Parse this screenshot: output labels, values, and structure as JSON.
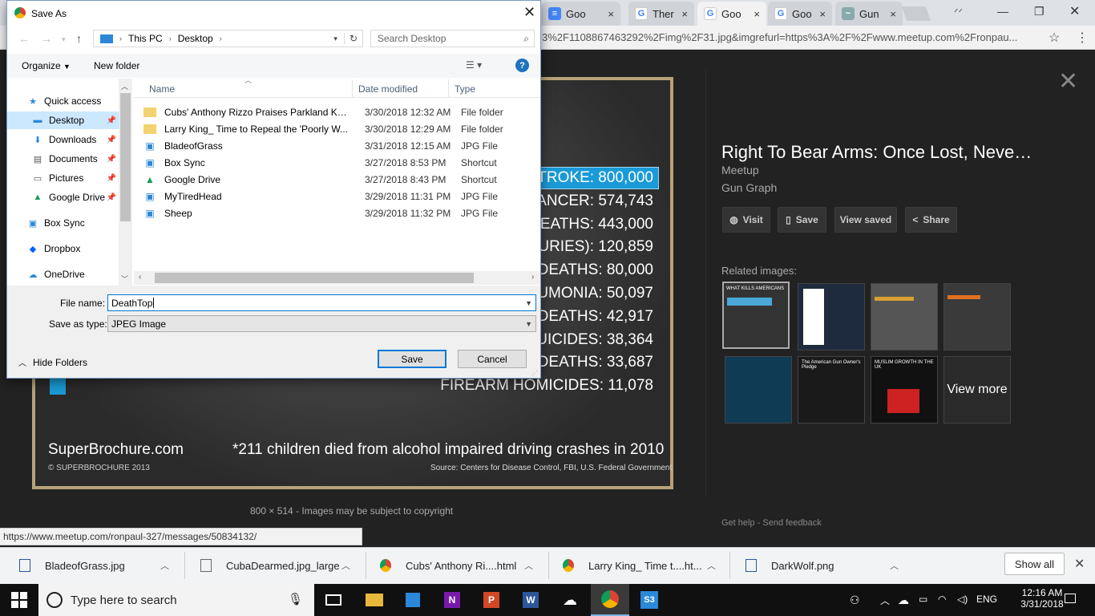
{
  "browser": {
    "tabs": [
      {
        "title": "Goo",
        "icon": "docs"
      },
      {
        "title": "Ther",
        "icon": "google"
      },
      {
        "title": "Goo",
        "icon": "google",
        "active": true
      },
      {
        "title": "Goo",
        "icon": "google"
      },
      {
        "title": "Gun",
        "icon": "image"
      }
    ],
    "url": "3%2F1108867463292%2Fimg%2F31.jpg&imgrefurl=https%3A%2F%2Fwww.meetup.com%2Fronpau..."
  },
  "image": {
    "stats": [
      {
        "text": "STROKE: 800,000",
        "highlight": true
      },
      {
        "text": "CANCER: 574,743"
      },
      {
        "text": "DEATHS: 443,000"
      },
      {
        "text": "JURIES): 120,859"
      },
      {
        "text": "DEATHS: 80,000"
      },
      {
        "text": "UMONIA: 50,097"
      },
      {
        "text": "DEATHS: 42,917"
      },
      {
        "text": "UICIDES: 38,364"
      },
      {
        "text": "DEATHS: 33,687"
      },
      {
        "text": "FIREARM HOMICIDES: 11,078"
      }
    ],
    "site": "SuperBrochure.com",
    "note": "*211 children died from alcohol impaired driving crashes in 2010",
    "copyright": "© SUPERBROCHURE 2013",
    "source": "Source: Centers for Disease Control, FBI, U.S. Federal Government",
    "heading_fragment": "S",
    "caption": "800 × 514 - Images may be subject to copyright"
  },
  "panel": {
    "title": "Right To Bear Arms: Once Lost, Neve…",
    "site": "Meetup",
    "subtitle": "Gun Graph",
    "buttons": {
      "visit": "Visit",
      "save": "Save",
      "view_saved": "View saved",
      "share": "Share"
    },
    "related_label": "Related images:",
    "thumb_texts": [
      "WHAT KILLS AMERICANS",
      "The American Gun Owner's Pledge",
      "MUSLIM GROWTH IN THE UK",
      "View more"
    ],
    "get_help": "Get help",
    "send_feedback": "Send feedback"
  },
  "status_url": "https://www.meetup.com/ronpaul-327/messages/50834132/",
  "downloads": {
    "items": [
      "BladeofGrass.jpg",
      "CubaDearmed.jpg_large",
      "Cubs' Anthony Ri....html",
      "Larry King_ Time t....ht...",
      "DarkWolf.png"
    ],
    "show_all": "Show all"
  },
  "taskbar": {
    "search_placeholder": "Type here to search",
    "language": "ENG",
    "time": "12:16 AM",
    "date": "3/31/2018"
  },
  "dialog": {
    "title": "Save As",
    "breadcrumb": [
      "This PC",
      "Desktop"
    ],
    "search_placeholder": "Search Desktop",
    "organize": "Organize",
    "new_folder": "New folder",
    "nav": [
      {
        "label": "Quick access",
        "icon": "star",
        "pinned": false
      },
      {
        "label": "Desktop",
        "icon": "desktop",
        "pinned": true,
        "selected": true
      },
      {
        "label": "Downloads",
        "icon": "download",
        "pinned": true
      },
      {
        "label": "Documents",
        "icon": "documents",
        "pinned": true
      },
      {
        "label": "Pictures",
        "icon": "pictures",
        "pinned": true
      },
      {
        "label": "Google Drive",
        "icon": "gdrive",
        "pinned": true
      },
      {
        "label": "Box Sync",
        "icon": "box",
        "pinned": false
      },
      {
        "label": "Dropbox",
        "icon": "dropbox",
        "pinned": false
      },
      {
        "label": "OneDrive",
        "icon": "onedrive",
        "pinned": false
      }
    ],
    "columns": {
      "name": "Name",
      "date": "Date modified",
      "type": "Type"
    },
    "files": [
      {
        "name": "Cubs' Anthony Rizzo Praises Parkland Kid...",
        "date": "3/30/2018 12:32 AM",
        "type": "File folder",
        "icon": "folder"
      },
      {
        "name": "Larry King_ Time to Repeal the 'Poorly W...",
        "date": "3/30/2018 12:29 AM",
        "type": "File folder",
        "icon": "folder"
      },
      {
        "name": "BladeofGrass",
        "date": "3/31/2018 12:15 AM",
        "type": "JPG File",
        "icon": "jpg"
      },
      {
        "name": "Box Sync",
        "date": "3/27/2018 8:53 PM",
        "type": "Shortcut",
        "icon": "box"
      },
      {
        "name": "Google Drive",
        "date": "3/27/2018 8:43 PM",
        "type": "Shortcut",
        "icon": "gdrive"
      },
      {
        "name": "MyTiredHead",
        "date": "3/29/2018 11:31 PM",
        "type": "JPG File",
        "icon": "jpg"
      },
      {
        "name": "Sheep",
        "date": "3/29/2018 11:32 PM",
        "type": "JPG File",
        "icon": "jpg"
      }
    ],
    "file_name_label": "File name:",
    "file_name_value": "DeathTop",
    "save_type_label": "Save as type:",
    "save_type_value": "JPEG Image",
    "save_button": "Save",
    "cancel_button": "Cancel",
    "hide_folders": "Hide Folders"
  }
}
